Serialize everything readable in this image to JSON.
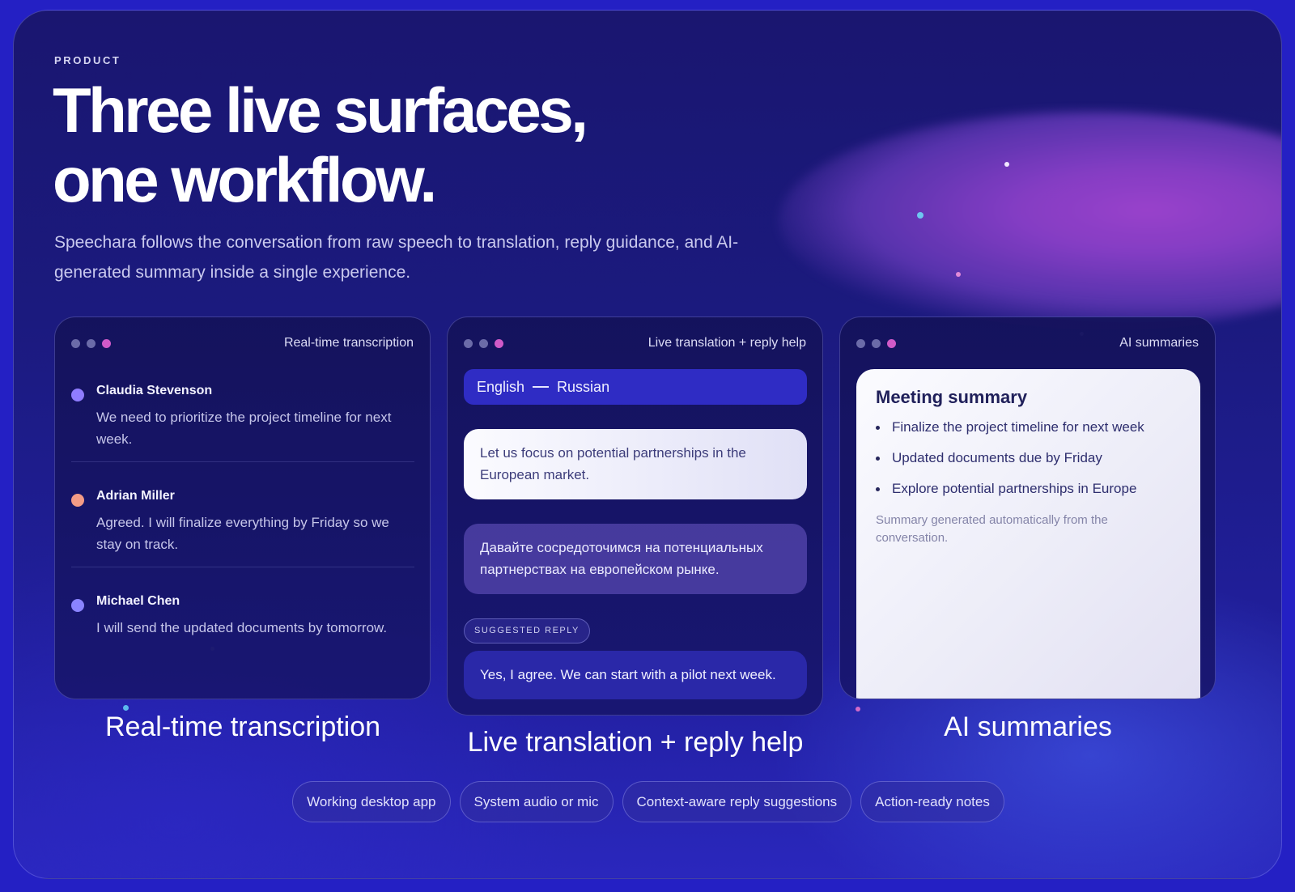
{
  "hero": {
    "eyebrow": "PRODUCT",
    "headline_line1": "Three live surfaces,",
    "headline_line2": "one workflow.",
    "subtitle": "Speechara follows the conversation from raw speech to translation, reply guidance, and AI-generated summary inside a single experience."
  },
  "colors": {
    "accent_purple": "#a045d0",
    "traffic_gray": "#6b6ba8",
    "traffic_pink": "#d05ac8",
    "avatar_violet": "#8f7cff",
    "avatar_peach": "#f39b86",
    "avatar_indigo": "#8a84ff"
  },
  "transcription_card": {
    "title": "Real-time transcription",
    "entries": [
      {
        "name": "Claudia Stevenson",
        "text": "We need to prioritize the project timeline for next week."
      },
      {
        "name": "Adrian Miller",
        "text": "Agreed. I will finalize everything by Friday so we stay on track."
      },
      {
        "name": "Michael Chen",
        "text": "I will send the updated documents by tomorrow."
      }
    ],
    "caption": "Real-time transcription"
  },
  "translation_card": {
    "title": "Live translation + reply help",
    "source_language": "English",
    "target_language": "Russian",
    "original_message": "Let us focus on potential partnerships in the European market.",
    "translated_message": "Давайте сосредоточимся на потенциальных партнерствах на европейском рынке.",
    "suggested_reply_label": "SUGGESTED REPLY",
    "suggested_reply": "Yes, I agree. We can start with a pilot next week.",
    "caption": "Live translation + reply help"
  },
  "summary_card": {
    "title": "AI summaries",
    "summary_title": "Meeting summary",
    "items": [
      "Finalize the project timeline for next week",
      "Updated documents due by Friday",
      "Explore potential partnerships in Europe"
    ],
    "note": "Summary generated automatically from the conversation.",
    "caption": "AI summaries"
  },
  "chips": [
    "Working desktop app",
    "System audio or mic",
    "Context-aware reply suggestions",
    "Action-ready notes"
  ]
}
